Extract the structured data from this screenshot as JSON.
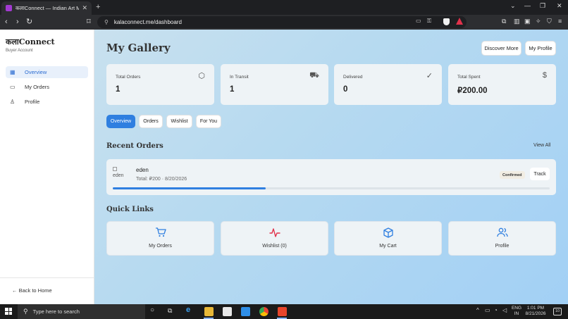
{
  "browser": {
    "tab_title": "कलाConnect — Indian Art Marke",
    "tab_close": "✕",
    "new_tab": "+",
    "url": "kalaconnect.me/dashboard"
  },
  "sidebar": {
    "brand": "कलाConnect",
    "subtitle": "Buyer Account",
    "items": [
      {
        "label": "Overview",
        "icon": "grid-icon",
        "active": true
      },
      {
        "label": "My Orders",
        "icon": "card-icon",
        "active": false
      },
      {
        "label": "Profile",
        "icon": "user-icon",
        "active": false
      }
    ],
    "back_label": "← Back to Home"
  },
  "header": {
    "title": "My Gallery",
    "discover_label": "Discover More",
    "profile_label": "My Profile"
  },
  "stats": [
    {
      "label": "Total Orders",
      "value": "1",
      "icon": "box-icon"
    },
    {
      "label": "In Transit",
      "value": "1",
      "icon": "truck-icon"
    },
    {
      "label": "Delivered",
      "value": "0",
      "icon": "check-circle-icon"
    },
    {
      "label": "Total Spent",
      "value": "₽200.00",
      "icon": "dollar-icon"
    }
  ],
  "tabs": [
    {
      "label": "Overview",
      "active": true
    },
    {
      "label": "Orders",
      "active": false
    },
    {
      "label": "Wishlist",
      "active": false
    },
    {
      "label": "For You",
      "active": false
    }
  ],
  "recent": {
    "title": "Recent Orders",
    "view_all": "View All",
    "order": {
      "image_alt": "eden",
      "name": "eden",
      "meta": "Total: ₽200 · 8/20/2026",
      "status": "Confirmed",
      "track_label": "Track",
      "progress": 0.35
    }
  },
  "quick_links": {
    "title": "Quick Links",
    "items": [
      {
        "label": "My Orders",
        "icon": "cart-icon",
        "color": "#2f7fe0"
      },
      {
        "label": "Wishlist (0)",
        "icon": "heartbeat-icon",
        "color": "#e0324b"
      },
      {
        "label": "My Cart",
        "icon": "package-icon",
        "color": "#2f7fe0"
      },
      {
        "label": "Profile",
        "icon": "users-icon",
        "color": "#2f7fe0"
      }
    ]
  },
  "taskbar": {
    "search_placeholder": "Type here to search",
    "lang": "ENG",
    "region": "IN",
    "time": "1:01 PM",
    "date": "8/21/2026",
    "notifications": "10"
  }
}
